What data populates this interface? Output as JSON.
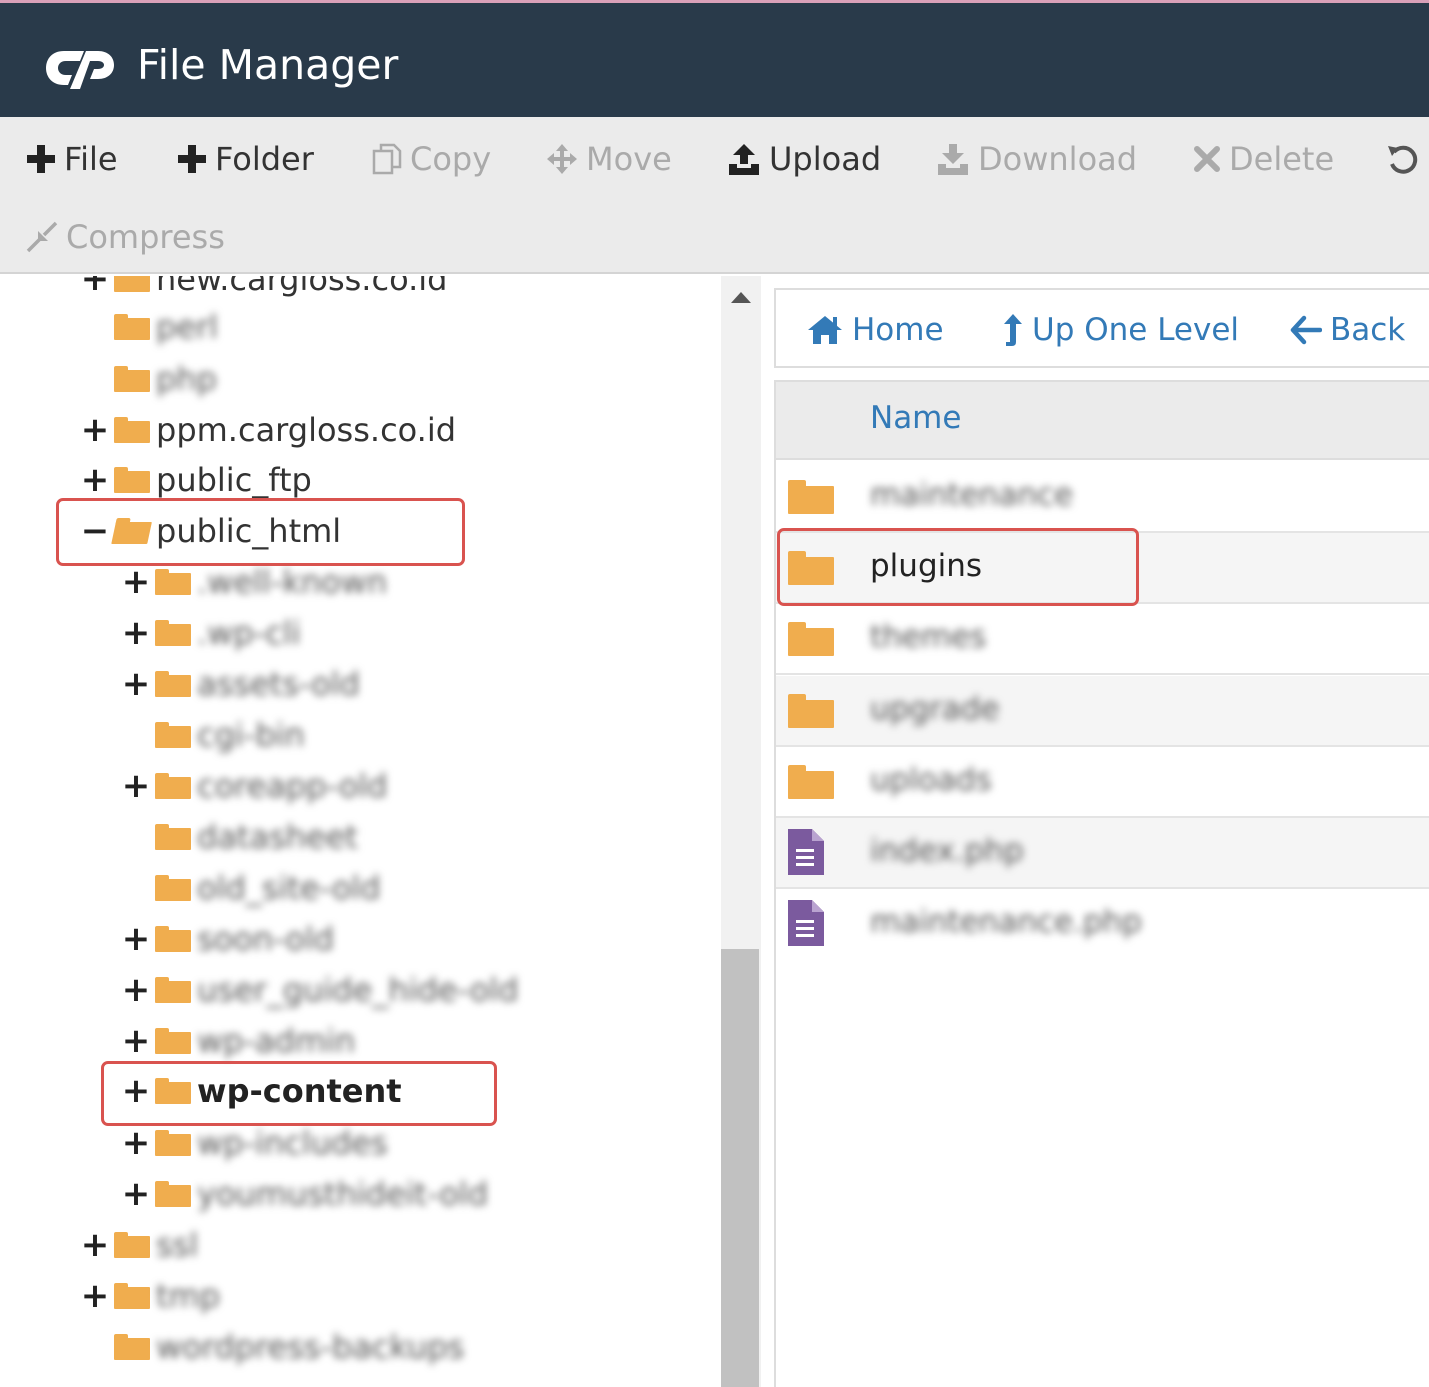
{
  "app": {
    "title": "File Manager",
    "logo": "cP"
  },
  "toolbar": {
    "file": "File",
    "folder": "Folder",
    "copy": "Copy",
    "move": "Move",
    "upload": "Upload",
    "download": "Download",
    "delete": "Delete",
    "compress": "Compress"
  },
  "tree": {
    "items": [
      {
        "label": "new.cargloss.co.id",
        "expander": "+"
      },
      {
        "label": "perl",
        "expander": ""
      },
      {
        "label": "php",
        "expander": ""
      },
      {
        "label": "ppm.cargloss.co.id",
        "expander": "+"
      },
      {
        "label": "public_ftp",
        "expander": "+"
      },
      {
        "label": "public_html",
        "expander": "−"
      },
      {
        "label": ".well-known",
        "expander": "+"
      },
      {
        "label": ".wp-cli",
        "expander": "+"
      },
      {
        "label": "assets-old",
        "expander": "+"
      },
      {
        "label": "cgi-bin",
        "expander": ""
      },
      {
        "label": "coreapp-old",
        "expander": "+"
      },
      {
        "label": "datasheet",
        "expander": ""
      },
      {
        "label": "old_site-old",
        "expander": ""
      },
      {
        "label": "soon-old",
        "expander": "+"
      },
      {
        "label": "user_guide_hide-old",
        "expander": "+"
      },
      {
        "label": "wp-admin",
        "expander": "+"
      },
      {
        "label": "wp-content",
        "expander": "+"
      },
      {
        "label": "wp-includes",
        "expander": "+"
      },
      {
        "label": "youmusthideit-old",
        "expander": "+"
      },
      {
        "label": "ssl",
        "expander": "+"
      },
      {
        "label": "tmp",
        "expander": "+"
      },
      {
        "label": "wordpress-backups",
        "expander": ""
      }
    ]
  },
  "nav": {
    "home": "Home",
    "up": "Up One Level",
    "back": "Back"
  },
  "listing": {
    "column_name": "Name",
    "files": [
      {
        "name": "maintenance",
        "type": "folder"
      },
      {
        "name": "plugins",
        "type": "folder"
      },
      {
        "name": "themes",
        "type": "folder"
      },
      {
        "name": "upgrade",
        "type": "folder"
      },
      {
        "name": "uploads",
        "type": "folder"
      },
      {
        "name": "index.php",
        "type": "file"
      },
      {
        "name": "maintenance.php",
        "type": "file"
      }
    ]
  },
  "colors": {
    "header": "#293a4a",
    "link": "#337ab7",
    "folder": "#f0ad4e",
    "highlight": "#d9534f",
    "file_icon": "#7b5a9e"
  }
}
